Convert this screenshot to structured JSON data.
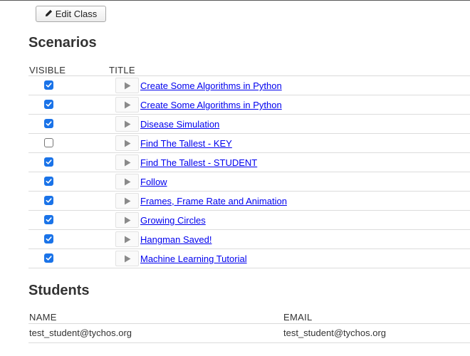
{
  "toolbar": {
    "edit_class_label": "Edit Class",
    "edit_icon": "pencil-icon"
  },
  "scenarios": {
    "heading": "Scenarios",
    "columns": {
      "visible": "VISIBLE",
      "title": "TITLE"
    },
    "rows": [
      {
        "visible": true,
        "title": "Create Some Algorithms in Python"
      },
      {
        "visible": true,
        "title": "Create Some Algorithms in Python"
      },
      {
        "visible": true,
        "title": "Disease Simulation"
      },
      {
        "visible": false,
        "title": "Find The Tallest - KEY"
      },
      {
        "visible": true,
        "title": "Find The Tallest - STUDENT"
      },
      {
        "visible": true,
        "title": "Follow"
      },
      {
        "visible": true,
        "title": "Frames, Frame Rate and Animation"
      },
      {
        "visible": true,
        "title": "Growing Circles"
      },
      {
        "visible": true,
        "title": "Hangman Saved!"
      },
      {
        "visible": true,
        "title": "Machine Learning Tutorial"
      }
    ]
  },
  "students": {
    "heading": "Students",
    "columns": {
      "name": "NAME",
      "email": "EMAIL"
    },
    "rows": [
      {
        "name": "test_student@tychos.org",
        "email": "test_student@tychos.org"
      }
    ]
  },
  "colors": {
    "link": "#0000ee",
    "checkbox_checked": "#1a73e8",
    "text": "#333333"
  }
}
